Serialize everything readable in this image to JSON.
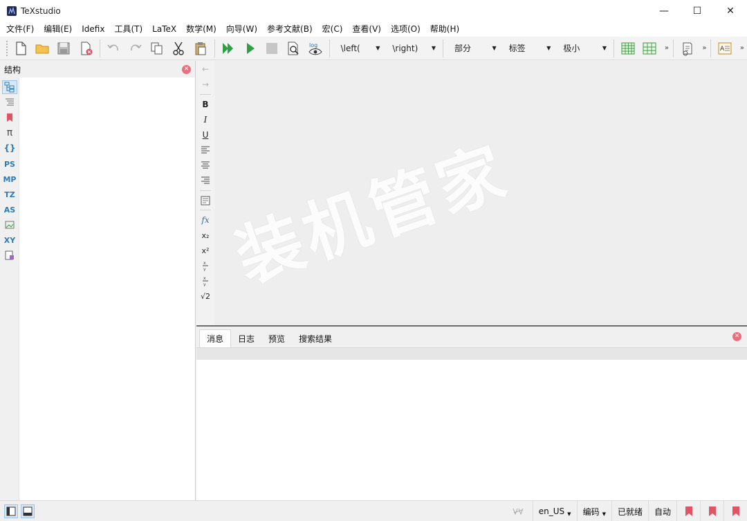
{
  "window": {
    "title": "TeXstudio",
    "minimize_glyph": "—",
    "maximize_glyph": "☐",
    "close_glyph": "✕"
  },
  "menu": [
    "文件(F)",
    "编辑(E)",
    "Idefix",
    "工具(T)",
    "LaTeX",
    "数学(M)",
    "向导(W)",
    "参考文献(B)",
    "宏(C)",
    "查看(V)",
    "选项(O)",
    "帮助(H)"
  ],
  "toolbar": {
    "log_label": "log",
    "combos": {
      "left": "\\left(",
      "right": "\\right)",
      "section": "部分",
      "label": "标签",
      "size": "极小"
    },
    "overflow_glyph": "»"
  },
  "structure": {
    "title": "结构",
    "tabs": [
      "",
      "",
      "",
      "",
      "",
      "PS",
      "MP",
      "TZ",
      "AS",
      "",
      "XY",
      ""
    ]
  },
  "format_toolbar": {
    "back": "←",
    "forward": "→",
    "bold": "B",
    "italic": "I",
    "underline": "U",
    "fx": "fx",
    "subscript": "x₂",
    "superscript": "x²",
    "sqrt": "√2"
  },
  "watermark": "装机管家",
  "messages": {
    "tabs": [
      "消息",
      "日志",
      "预览",
      "搜索结果"
    ],
    "active_index": 0
  },
  "status": {
    "language": "en_US",
    "encoding": "编码",
    "ready": "已就绪",
    "mode": "自动"
  },
  "colors": {
    "accent_green": "#2ea043",
    "bookmark_red": "#e05566",
    "table_green": "#3b9b3b",
    "struct_blue": "#2b7bb9"
  }
}
